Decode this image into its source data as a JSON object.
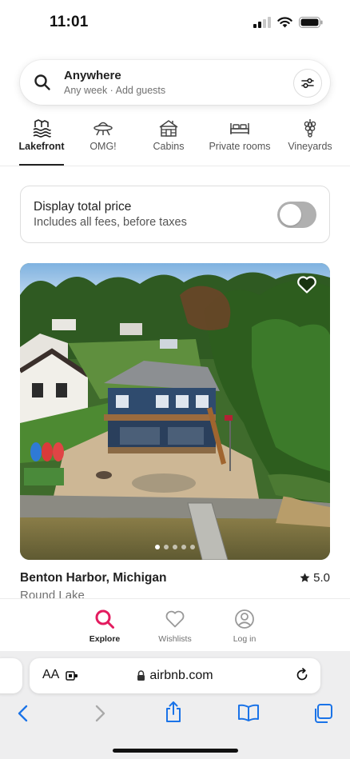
{
  "status_bar": {
    "time": "11:01"
  },
  "search": {
    "title": "Anywhere",
    "subtitle": "Any week · Add guests"
  },
  "categories": [
    {
      "label": "Lakefront",
      "icon": "lakefront-icon",
      "active": true
    },
    {
      "label": "OMG!",
      "icon": "ufo-house-icon",
      "active": false
    },
    {
      "label": "Cabins",
      "icon": "cabin-icon",
      "active": false
    },
    {
      "label": "Private rooms",
      "icon": "bed-icon",
      "active": false
    },
    {
      "label": "Vineyards",
      "icon": "grapes-icon",
      "active": false
    }
  ],
  "price_toggle": {
    "title": "Display total price",
    "subtitle": "Includes all fees, before taxes",
    "on": false
  },
  "listing": {
    "location": "Benton Harbor, Michigan",
    "rating": "5.0",
    "subtitle": "Round Lake",
    "photo_count": 5,
    "current_photo": 1
  },
  "bottom_nav": [
    {
      "label": "Explore",
      "icon": "search-icon",
      "active": true
    },
    {
      "label": "Wishlists",
      "icon": "heart-icon",
      "active": false
    },
    {
      "label": "Log in",
      "icon": "user-icon",
      "active": false
    }
  ],
  "browser": {
    "aa_label": "AA",
    "url": "airbnb.com"
  },
  "colors": {
    "brand": "#E31C5F",
    "text": "#222222",
    "muted": "#717171",
    "toggle_off": "#B0B0B0"
  }
}
